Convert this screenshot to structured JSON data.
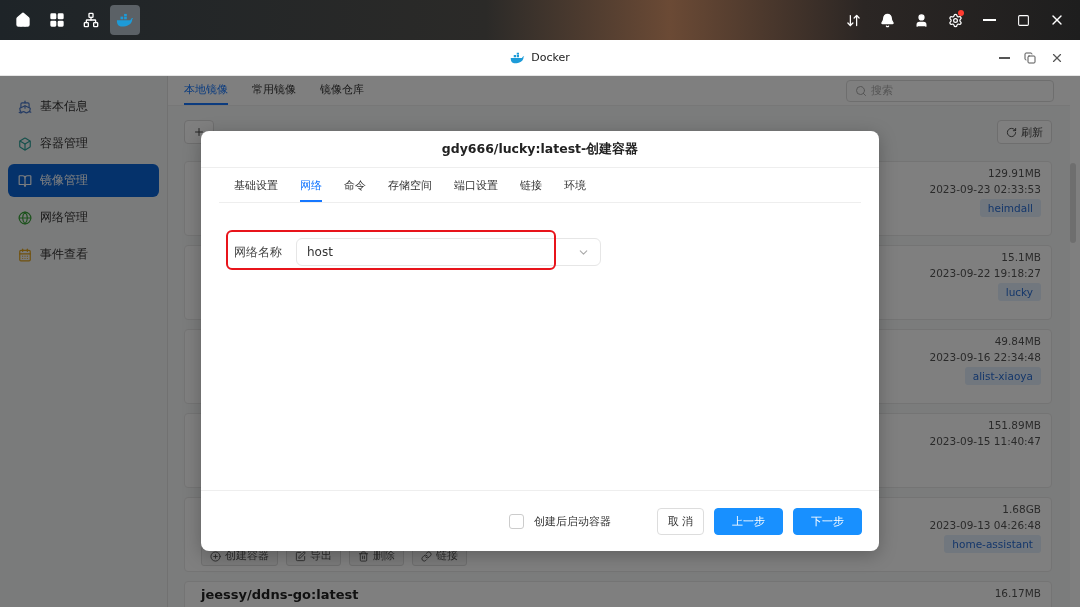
{
  "taskbar": {
    "apps": [
      {
        "kind": "home",
        "selected": false
      },
      {
        "kind": "apps",
        "selected": false
      },
      {
        "kind": "network",
        "selected": false
      },
      {
        "kind": "docker",
        "selected": true
      }
    ],
    "tray": [
      {
        "kind": "transfer",
        "badge": false
      },
      {
        "kind": "bell",
        "badge": false
      },
      {
        "kind": "user",
        "badge": false
      },
      {
        "kind": "settings",
        "badge": true
      }
    ]
  },
  "window": {
    "title": "Docker"
  },
  "sidebar": {
    "items": [
      {
        "label": "基本信息",
        "kind": "info",
        "selected": false
      },
      {
        "label": "容器管理",
        "kind": "container",
        "selected": false
      },
      {
        "label": "镜像管理",
        "kind": "image",
        "selected": true
      },
      {
        "label": "网络管理",
        "kind": "network",
        "selected": false
      },
      {
        "label": "事件查看",
        "kind": "events",
        "selected": false
      }
    ]
  },
  "tabs": [
    {
      "label": "本地镜像",
      "selected": true
    },
    {
      "label": "常用镜像",
      "selected": false
    },
    {
      "label": "镜像仓库",
      "selected": false
    }
  ],
  "search": {
    "placeholder": "搜索"
  },
  "toolbar": {
    "refresh": "刷新"
  },
  "images": [
    {
      "size": "129.91MB",
      "date": "2023-09-23 02:33:53",
      "tag": "heimdall"
    },
    {
      "size": "15.1MB",
      "date": "2023-09-22 19:18:27",
      "tag": "lucky"
    },
    {
      "size": "49.84MB",
      "date": "2023-09-16 22:34:48",
      "tag": "alist-xiaoya"
    },
    {
      "size": "151.89MB",
      "date": "2023-09-15 11:40:47"
    },
    {
      "size": "1.68GB",
      "date": "2023-09-13 04:26:48",
      "tag": "home-assistant",
      "actions": [
        {
          "kind": "create",
          "label": "创建容器"
        },
        {
          "kind": "export",
          "label": "导出"
        },
        {
          "kind": "delete",
          "label": "删除"
        },
        {
          "kind": "link",
          "label": "链接"
        }
      ]
    },
    {
      "name": "jeessy/ddns-go:latest",
      "size": "16.17MB"
    }
  ],
  "dialog": {
    "title": "gdy666/lucky:latest-创建容器",
    "tabs": [
      {
        "label": "基础设置",
        "selected": false
      },
      {
        "label": "网络",
        "selected": true
      },
      {
        "label": "命令",
        "selected": false
      },
      {
        "label": "存储空间",
        "selected": false
      },
      {
        "label": "端口设置",
        "selected": false
      },
      {
        "label": "链接",
        "selected": false
      },
      {
        "label": "环境",
        "selected": false
      }
    ],
    "field": {
      "label": "网络名称",
      "value": "host"
    },
    "start_after_create": {
      "label": "创建后启动容器",
      "checked": false
    },
    "buttons": [
      {
        "label": "取 消",
        "kind": "default"
      },
      {
        "label": "上一步",
        "kind": "primary"
      },
      {
        "label": "下一步",
        "kind": "primary"
      }
    ]
  }
}
